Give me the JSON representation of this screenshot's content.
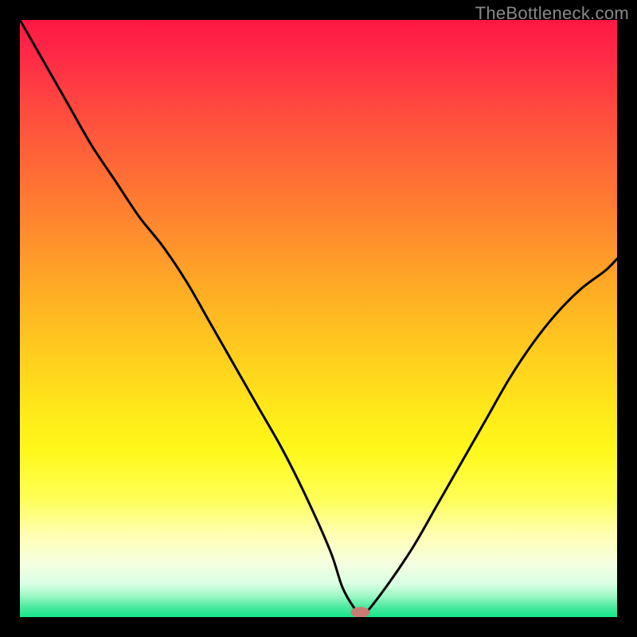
{
  "watermark": "TheBottleneck.com",
  "chart_data": {
    "type": "line",
    "title": "",
    "xlabel": "",
    "ylabel": "",
    "xlim": [
      0,
      100
    ],
    "ylim": [
      0,
      100
    ],
    "background_gradient": {
      "stops": [
        {
          "offset": 0.0,
          "color": "#ff1744"
        },
        {
          "offset": 0.06,
          "color": "#ff2a47"
        },
        {
          "offset": 0.15,
          "color": "#ff4a3f"
        },
        {
          "offset": 0.25,
          "color": "#ff6a36"
        },
        {
          "offset": 0.35,
          "color": "#ff8a2e"
        },
        {
          "offset": 0.45,
          "color": "#ffab25"
        },
        {
          "offset": 0.55,
          "color": "#ffca1f"
        },
        {
          "offset": 0.65,
          "color": "#ffe71a"
        },
        {
          "offset": 0.72,
          "color": "#fff81a"
        },
        {
          "offset": 0.8,
          "color": "#ffff55"
        },
        {
          "offset": 0.86,
          "color": "#ffffb0"
        },
        {
          "offset": 0.91,
          "color": "#f5ffe0"
        },
        {
          "offset": 0.945,
          "color": "#d8ffe4"
        },
        {
          "offset": 0.965,
          "color": "#9cf7c4"
        },
        {
          "offset": 0.983,
          "color": "#4de9a0"
        },
        {
          "offset": 1.0,
          "color": "#14e68a"
        }
      ]
    },
    "series": [
      {
        "name": "bottleneck-curve",
        "x": [
          0,
          4,
          8,
          12,
          16,
          20,
          24,
          28,
          32,
          36,
          40,
          44,
          48,
          52,
          54,
          56,
          57,
          58,
          62,
          66,
          70,
          74,
          78,
          82,
          86,
          90,
          94,
          98,
          100
        ],
        "y": [
          100,
          93,
          86,
          79,
          73,
          67,
          62,
          56,
          49,
          42,
          35,
          28,
          20,
          11,
          5,
          1.5,
          0.8,
          0.8,
          6,
          12,
          19,
          26,
          33,
          40,
          46,
          51,
          55,
          58,
          60
        ]
      }
    ],
    "marker": {
      "name": "optimal-point",
      "x": 57,
      "y": 0.8,
      "color": "#c97b74",
      "rx": 1.6,
      "ry": 0.9
    }
  }
}
